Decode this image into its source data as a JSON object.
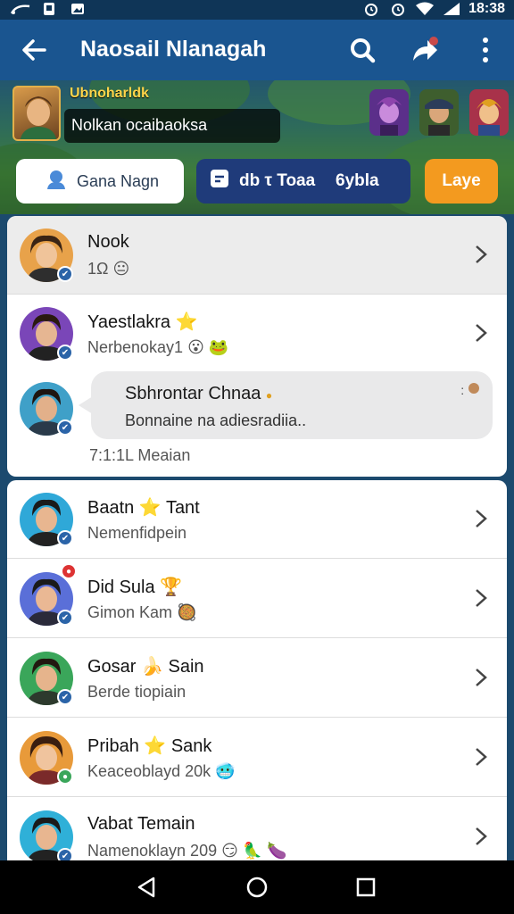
{
  "status_bar": {
    "time": "18:38",
    "left_icons": [
      "cast-icon",
      "key-icon",
      "gallery-icon"
    ],
    "right_icons": [
      "alarm-icon",
      "alarm-icon",
      "wifi-icon",
      "signal-icon"
    ]
  },
  "app_bar": {
    "title": "Naosail Nlanagah",
    "icons": [
      "back-arrow-icon",
      "search-icon",
      "share-icon",
      "more-vert-icon"
    ]
  },
  "hero": {
    "username": "Ubnoharldk",
    "status_text": "Nolkan ocaibaoksa",
    "buttons": {
      "group": "Gana Nagn",
      "seg_left": "db τ Toaa",
      "seg_right": "6ybla",
      "join": "Laye"
    }
  },
  "chats": [
    {
      "name": "Nook",
      "sub": "1Ω",
      "emoji": "😐"
    },
    {
      "name": "Yaestlakra",
      "name_emoji": "⭐",
      "sub": "Nerbenokay1",
      "emoji": "😮 🐸"
    },
    {
      "name": "Baatn",
      "name_emoji": "⭐",
      "name2": "Tant",
      "sub": "Nemenfidpein"
    },
    {
      "name": "Did Sula",
      "name_emoji": "🏆",
      "sub": "Gimon Kam",
      "emoji": "🥘"
    },
    {
      "name": "Gosar",
      "name_emoji": "🍌",
      "name2": "Sain",
      "sub": "Berde tiopiain"
    },
    {
      "name": "Pribah",
      "name_emoji": "⭐",
      "name2": "Sank",
      "sub": "Keaceoblayd 20k",
      "emoji": "🥶"
    },
    {
      "name": "Vabat Temain",
      "sub": "Namenoklayn 209",
      "emoji": "😏 🦜 🍆"
    }
  ],
  "expanded": {
    "bubble_name": "Sbhrontar Chnaa",
    "bubble_text": "Bonnaine na adiesradiia..",
    "bubble_mark": ":",
    "meta": "7:1:1L Meaian"
  },
  "colors": {
    "app_bar": "#1a5590",
    "status_bar": "#0f3557",
    "join_button": "#f39a1f",
    "seg_button": "#1f3b7a"
  }
}
